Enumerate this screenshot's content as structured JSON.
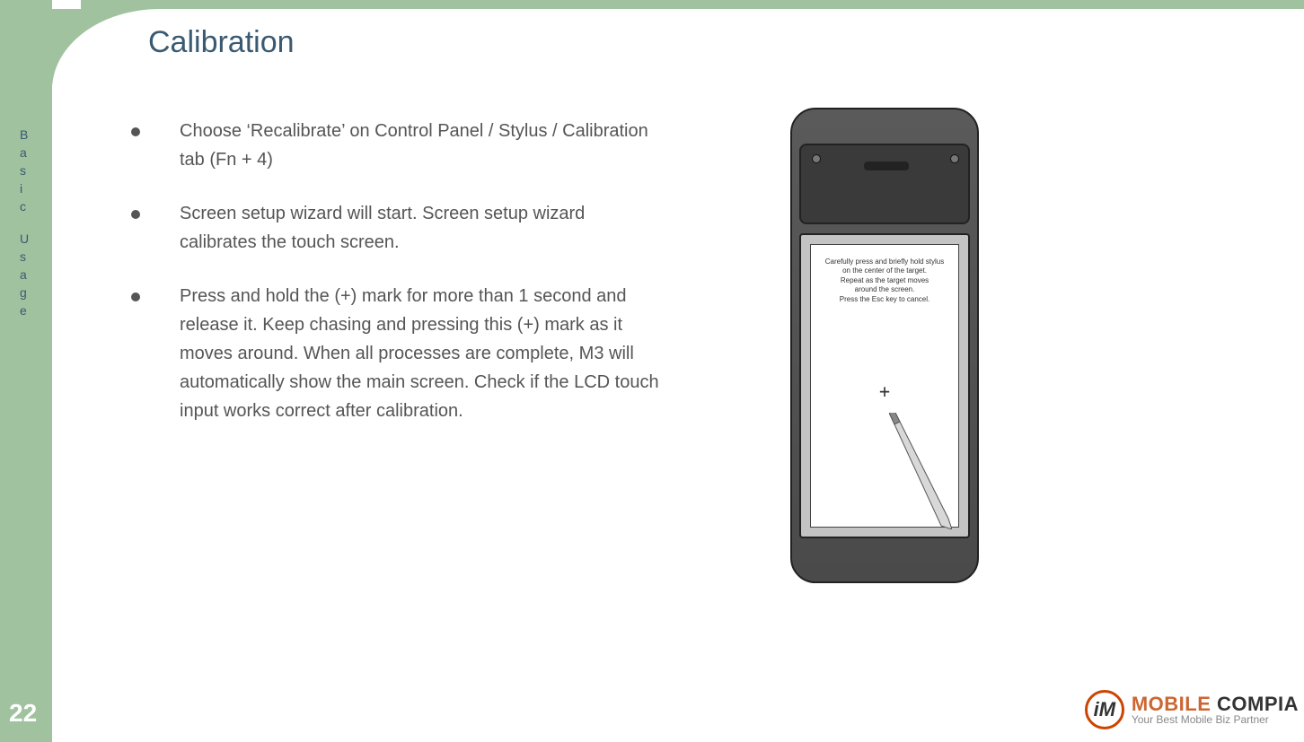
{
  "page": {
    "title": "Calibration",
    "number": "22",
    "side_label": [
      "B",
      "a",
      "s",
      "i",
      "c",
      "",
      "U",
      "s",
      "a",
      "g",
      "e"
    ]
  },
  "bullets": [
    "Choose ‘Recalibrate’ on Control Panel / Stylus / Calibration tab (Fn + 4)",
    "Screen setup wizard will start. Screen setup wizard calibrates the touch screen.",
    "Press and hold the (+) mark for more than 1 second and release it. Keep chasing and pressing this (+) mark as it moves around. When all processes are complete, M3 will automatically show the main screen. Check if the LCD touch input works correct after calibration."
  ],
  "device_screen": {
    "instruction_lines": [
      "Carefully press and briefly hold stylus",
      "on the center of the target.",
      "Repeat as the target moves",
      "around the screen.",
      "Press the Esc key to cancel."
    ],
    "target_symbol": "+"
  },
  "logo": {
    "badge_letter": "iM",
    "word1": "MOBILE ",
    "word2": "COMPIA",
    "tagline": "Your Best Mobile Biz Partner"
  }
}
